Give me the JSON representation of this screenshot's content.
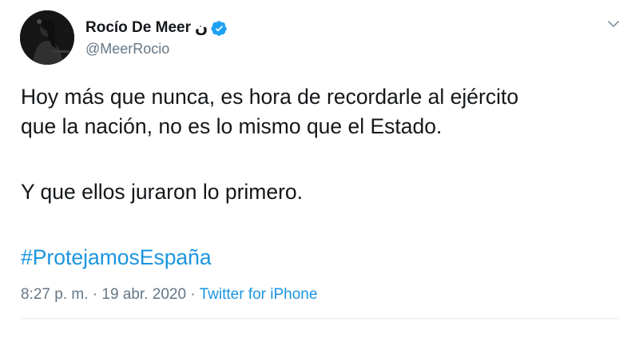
{
  "tweet": {
    "author": {
      "display_name": "Rocío De Meer",
      "name_emoji": "ن",
      "handle": "@MeerRocio",
      "verified": true
    },
    "text": {
      "line1": "Hoy más que nunca, es hora de recordarle al ejército",
      "line2": "que la nación, no es lo mismo que el Estado.",
      "line3": "Y que ellos juraron lo primero.",
      "hashtag": "#ProtejamosEspaña"
    },
    "meta": {
      "time": "8:27 p. m.",
      "separator1": " · ",
      "date": "19 abr. 2020",
      "separator2": " · ",
      "source": "Twitter for iPhone"
    }
  },
  "colors": {
    "link": "#1b95e0",
    "muted": "#657786",
    "text": "#14171a",
    "verified_badge": "#1da1f2"
  },
  "icons": {
    "verified": "verified-badge-icon",
    "menu": "chevron-down-icon"
  }
}
